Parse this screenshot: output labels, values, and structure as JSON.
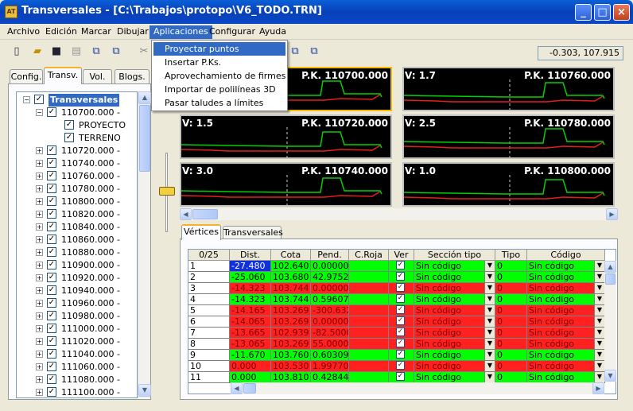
{
  "window": {
    "title": "Transversales - [C:\\Trabajos\\protopo\\V6_TODO.TRN]"
  },
  "menu": [
    "Archivo",
    "Edición",
    "Marcar",
    "Dibujar",
    "Aplicaciones",
    "Configurar",
    "Ayuda"
  ],
  "dropdown": {
    "items": [
      "Proyectar puntos",
      "Insertar P.Ks.",
      "Aprovechamiento de firmes",
      "Importar de polilíneas 3D",
      "Pasar taludes a límites"
    ],
    "highlighted": "Proyectar puntos"
  },
  "coords": "-0.303, 107.915",
  "left_tabs": [
    "Config.",
    "Transv.",
    "Vol.",
    "Blogs."
  ],
  "tree": {
    "root": "Transversales",
    "expanded": {
      "label": "110700.000 -",
      "children": [
        "PROYECTO",
        "TERRENO"
      ]
    },
    "items": [
      "110720.000 -",
      "110740.000 -",
      "110760.000 -",
      "110780.000 -",
      "110800.000 -",
      "110820.000 -",
      "110840.000 -",
      "110860.000 -",
      "110880.000 -",
      "110900.000 -",
      "110920.000 -",
      "110940.000 -",
      "110960.000 -",
      "110980.000 -",
      "111000.000 -",
      "111020.000 -",
      "111040.000 -",
      "111060.000 -",
      "111080.000 -",
      "111100.000 -"
    ]
  },
  "sections": [
    {
      "v": "",
      "pk": "P.K. 110700.000",
      "selected": true
    },
    {
      "v": "V: 1.7",
      "pk": "P.K. 110760.000"
    },
    {
      "v": "V: 1.5",
      "pk": "P.K. 110720.000"
    },
    {
      "v": "V: 2.5",
      "pk": "P.K. 110780.000"
    },
    {
      "v": "V: 3.0",
      "pk": "P.K. 110740.000"
    },
    {
      "v": "V: 1.0",
      "pk": "P.K. 110800.000"
    }
  ],
  "bottom_tabs": [
    "Vértices",
    "Transversales"
  ],
  "grid": {
    "columns": [
      "0/25",
      "Dist.",
      "Cota",
      "Pend.",
      "C.Roja",
      "Ver",
      "Sección tipo",
      "Tipo",
      "Código"
    ],
    "rows": [
      {
        "n": "1",
        "dist": "-27.480",
        "cota": "102.640",
        "pend": "0.000000",
        "ok": true
      },
      {
        "n": "2",
        "dist": "-25.060",
        "cota": "103.680",
        "pend": "42.97520",
        "ok": true
      },
      {
        "n": "3",
        "dist": "-14.323",
        "cota": "103.744",
        "pend": "0.000000",
        "ok": false
      },
      {
        "n": "4",
        "dist": "-14.323",
        "cota": "103.744",
        "pend": "0.596070",
        "ok": true
      },
      {
        "n": "5",
        "dist": "-14.165",
        "cota": "103.269",
        "pend": "-300.632",
        "ok": false
      },
      {
        "n": "6",
        "dist": "-14.065",
        "cota": "103.269",
        "pend": "0.000000",
        "ok": false
      },
      {
        "n": "7",
        "dist": "-13.665",
        "cota": "102.939",
        "pend": "-82.5000",
        "ok": false
      },
      {
        "n": "8",
        "dist": "-13.065",
        "cota": "103.269",
        "pend": "55.00000",
        "ok": false
      },
      {
        "n": "9",
        "dist": "-11.670",
        "cota": "103.760",
        "pend": "0.603091",
        "ok": true
      },
      {
        "n": "10",
        "dist": "0.000",
        "cota": "103.530",
        "pend": "1.997704",
        "ok": false
      },
      {
        "n": "11",
        "dist": "0.000",
        "cota": "103.810",
        "pend": "0.428445",
        "ok": true
      }
    ],
    "seccion": "Sin código",
    "tipo": "0",
    "codigo": "Sin código"
  },
  "colors": {
    "ok": "#00ff00",
    "bad": "#ff2020",
    "accent": "#316ac5"
  }
}
